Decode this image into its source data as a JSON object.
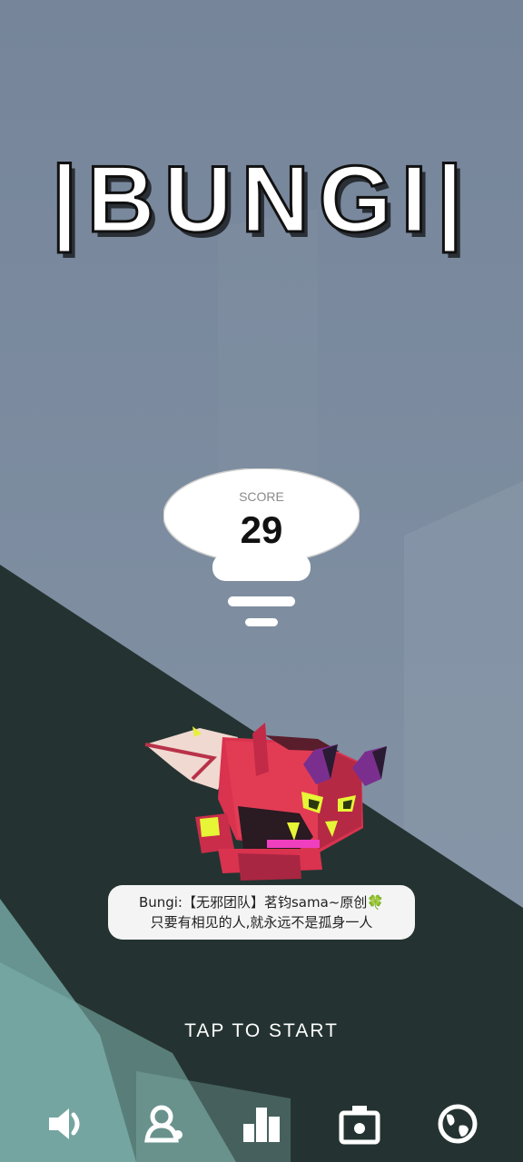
{
  "title": "|BUNGI|",
  "score": {
    "label": "SCORE",
    "value": "29"
  },
  "credit": {
    "line1": "Bungi:【无邪团队】茗钧sama~原创🍀",
    "line2": "只要有相见的人,就永远不是孤身一人"
  },
  "start_prompt": "TAP TO START",
  "toolbar": [
    {
      "name": "sound-button",
      "icon": "speaker-icon"
    },
    {
      "name": "account-button",
      "icon": "user-icon"
    },
    {
      "name": "leaderboard-button",
      "icon": "bar-chart-icon"
    },
    {
      "name": "camera-button",
      "icon": "camera-icon"
    },
    {
      "name": "language-button",
      "icon": "globe-icon"
    }
  ],
  "colors": {
    "sky": "#7f8e9f",
    "slope": "#243331",
    "character": "#d9334f",
    "ui_white": "#ffffff"
  }
}
